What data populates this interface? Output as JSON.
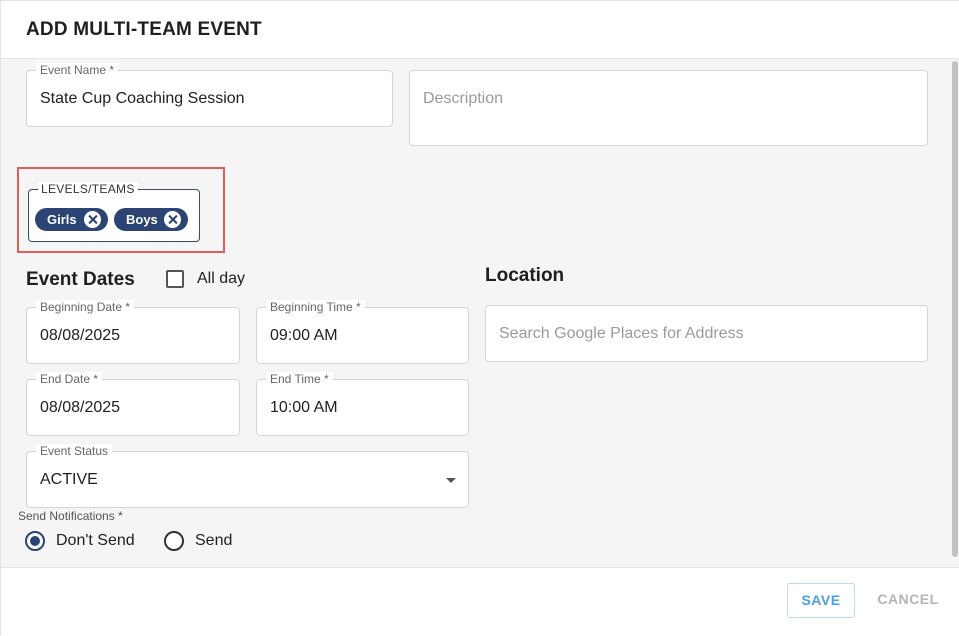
{
  "dialog": {
    "title": "ADD MULTI-TEAM EVENT"
  },
  "event_name": {
    "label": "Event Name *",
    "value": "State Cup Coaching Session"
  },
  "description": {
    "placeholder": "Description"
  },
  "levels_teams": {
    "label": "LEVELS/TEAMS",
    "chips": [
      {
        "label": "Girls"
      },
      {
        "label": "Boys"
      }
    ]
  },
  "event_dates": {
    "title": "Event Dates",
    "all_day_label": "All day",
    "all_day_checked": false,
    "beginning_date": {
      "label": "Beginning Date *",
      "value": "08/08/2025"
    },
    "beginning_time": {
      "label": "Beginning Time *",
      "value": "09:00 AM"
    },
    "end_date": {
      "label": "End Date *",
      "value": "08/08/2025"
    },
    "end_time": {
      "label": "End Time *",
      "value": "10:00 AM"
    }
  },
  "event_status": {
    "label": "Event Status",
    "value": "ACTIVE"
  },
  "location": {
    "title": "Location",
    "placeholder": "Search Google Places for Address"
  },
  "notifications": {
    "label": "Send Notifications *",
    "options": [
      {
        "label": "Don't Send",
        "checked": true
      },
      {
        "label": "Send",
        "checked": false
      }
    ]
  },
  "footer": {
    "save_label": "SAVE",
    "cancel_label": "CANCEL"
  },
  "colors": {
    "accent": "#2b4473",
    "highlight": "#e35c5c",
    "save_text": "#4a9fe0"
  }
}
